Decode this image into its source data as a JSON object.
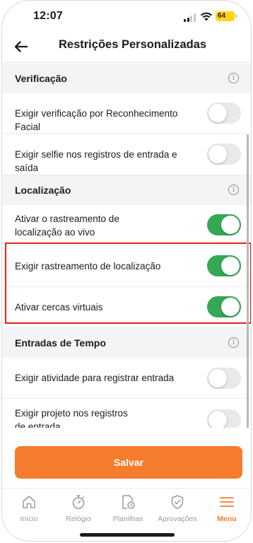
{
  "status_bar": {
    "time": "12:07",
    "battery": "64"
  },
  "header": {
    "title": "Restrições Personalizadas"
  },
  "sections": [
    {
      "title": "Verificação",
      "items": [
        {
          "label": "Exigir verificação por Reconhecimento Facial",
          "enabled": false
        },
        {
          "label": "Exigir selfie nos registros de entrada e saída",
          "enabled": false
        }
      ]
    },
    {
      "title": "Localização",
      "items": [
        {
          "label": "Ativar o rastreamento de localização ao vivo",
          "enabled": true
        },
        {
          "label": "Exigir rastreamento de localização",
          "enabled": true
        },
        {
          "label": "Ativar cercas virtuais",
          "enabled": true
        }
      ]
    },
    {
      "title": "Entradas de Tempo",
      "items": [
        {
          "label": "Exigir atividade para registrar entrada",
          "enabled": false
        },
        {
          "label": "Exigir projeto nos registros de entrada",
          "enabled": false
        }
      ]
    }
  ],
  "info_glyph": "i",
  "save_label": "Salvar",
  "tabs": [
    {
      "label": "Início",
      "icon": "home-icon",
      "active": false
    },
    {
      "label": "Relógio",
      "icon": "stopwatch-icon",
      "active": false
    },
    {
      "label": "Planilhas",
      "icon": "timesheet-icon",
      "active": false
    },
    {
      "label": "Aprovações",
      "icon": "shield-check-icon",
      "active": false
    },
    {
      "label": "Menu",
      "icon": "menu-icon",
      "active": true
    }
  ],
  "colors": {
    "accent": "#f47c2c",
    "toggle_on": "#34a853",
    "toggle_off": "#e9e9ea",
    "highlight": "#e2231a"
  }
}
